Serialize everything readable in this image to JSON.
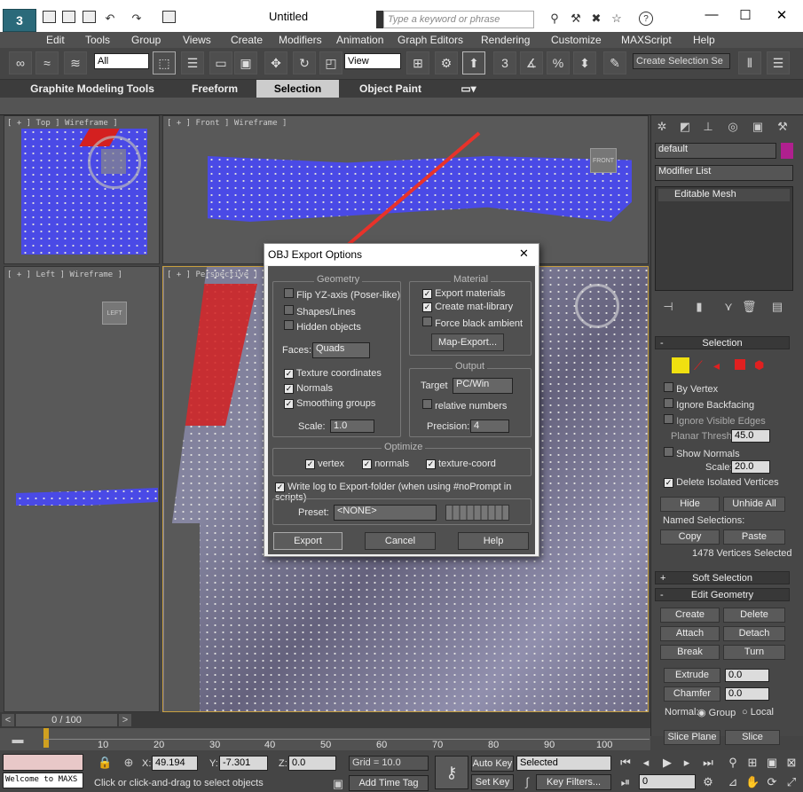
{
  "window": {
    "title": "Untitled",
    "search_placeholder": "Type a keyword or phrase"
  },
  "menu": [
    "Edit",
    "Tools",
    "Group",
    "Views",
    "Create",
    "Modifiers",
    "Animation",
    "Graph Editors",
    "Rendering",
    "Customize",
    "MAXScript",
    "Help"
  ],
  "toolbar": {
    "selection_filter": "All",
    "ref_coord": "View",
    "named_selection_placeholder": "Create Selection Se"
  },
  "ribbon": {
    "tabs": [
      "Graphite Modeling Tools",
      "Freeform",
      "Selection",
      "Object Paint"
    ],
    "active": "Selection"
  },
  "viewports": {
    "top": "[ + ] Top ] Wireframe ]",
    "front": "[ + ] Front ] Wireframe ]",
    "left": "[ + ] Left ] Wireframe ]",
    "perspective": "[ + ] Perspective ]",
    "viewcube_front": "FRONT",
    "viewcube_left": "LEFT"
  },
  "dialog": {
    "title": "OBJ Export Options",
    "geometry": {
      "title": "Geometry",
      "flip": "Flip YZ-axis (Poser-like)",
      "shapes": "Shapes/Lines",
      "hidden": "Hidden objects",
      "faces_label": "Faces:",
      "faces_value": "Quads",
      "texcoords": "Texture coordinates",
      "normals": "Normals",
      "smoothing": "Smoothing groups",
      "scale_label": "Scale:",
      "scale_value": "1.0"
    },
    "material": {
      "title": "Material",
      "export": "Export materials",
      "matlib": "Create mat-library",
      "black": "Force black ambient",
      "map_export": "Map-Export..."
    },
    "output": {
      "title": "Output",
      "target_label": "Target",
      "target_value": "PC/Win",
      "relative": "relative numbers",
      "precision_label": "Precision:",
      "precision_value": "4"
    },
    "optimize": {
      "title": "Optimize",
      "vertex": "vertex",
      "normals": "normals",
      "texcoord": "texture-coord"
    },
    "writelog": "Write log to Export-folder (when using #noPrompt in scripts)",
    "preset_label": "Preset:",
    "preset_value": "<NONE>",
    "export": "Export",
    "cancel": "Cancel",
    "help": "Help"
  },
  "panel": {
    "object_name": "default",
    "object_color": "#b0208f",
    "modifier_list": "Modifier List",
    "stack_item": "Editable Mesh",
    "selection": {
      "title": "Selection",
      "by_vertex": "By Vertex",
      "ignore_backfacing": "Ignore Backfacing",
      "ignore_visible": "Ignore Visible Edges",
      "planar_label": "Planar Thresh:",
      "planar_value": "45.0",
      "show_normals": "Show Normals",
      "scale_label": "Scale:",
      "scale_value": "20.0",
      "delete_isolated": "Delete Isolated Vertices",
      "hide": "Hide",
      "unhide": "Unhide All",
      "named_sel": "Named Selections:",
      "copy": "Copy",
      "paste": "Paste",
      "status": "1478 Vertices Selected"
    },
    "soft_selection": "Soft Selection",
    "edit_geometry": {
      "title": "Edit Geometry",
      "create": "Create",
      "delete": "Delete",
      "attach": "Attach",
      "detach": "Detach",
      "break": "Break",
      "turn": "Turn",
      "extrude": "Extrude",
      "extrude_value": "0.0",
      "chamfer": "Chamfer",
      "chamfer_value": "0.0",
      "normal_label": "Normal:",
      "group": "Group",
      "local": "Local",
      "slice_plane": "Slice Plane",
      "slice": "Slice"
    }
  },
  "timeline": {
    "frame": "0 / 100",
    "ticks": [
      "0",
      "10",
      "20",
      "30",
      "40",
      "50",
      "60",
      "70",
      "80",
      "90",
      "100"
    ]
  },
  "status": {
    "script": "Welcome to MAXS",
    "prompt": "Click or click-and-drag to select objects",
    "x_label": "X:",
    "x": "49.194",
    "y_label": "Y:",
    "y": "-7.301",
    "z_label": "Z:",
    "z": "0.0",
    "grid": "Grid = 10.0",
    "add_time_tag": "Add Time Tag",
    "auto_key": "Auto Key",
    "set_key": "Set Key",
    "key_mode": "Selected",
    "key_filters": "Key Filters...",
    "frame_field": "0"
  },
  "colors": {
    "arrow": "#e8322a",
    "mesh": "#4a4ae6",
    "selected": "#d42020"
  }
}
